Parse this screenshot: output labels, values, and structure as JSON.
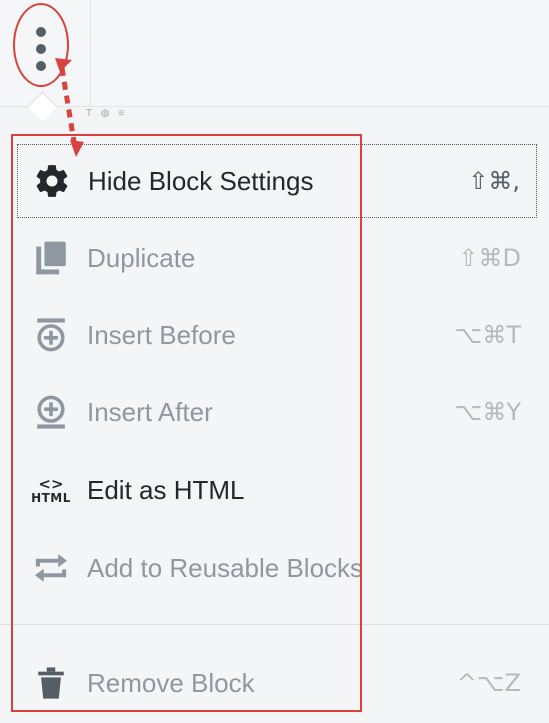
{
  "toolbar": {
    "more_button_icon": "vertical-ellipsis-icon",
    "mini_toolbar_text": "T ◍ ≡"
  },
  "menu": {
    "items": [
      {
        "label": "Hide Block Settings",
        "shortcut": "⇧⌘,",
        "icon": "gear-icon",
        "state": "focused"
      },
      {
        "label": "Duplicate",
        "shortcut": "⇧⌘D",
        "icon": "duplicate-icon",
        "state": "disabled"
      },
      {
        "label": "Insert Before",
        "shortcut": "⌥⌘T",
        "icon": "insert-before-icon",
        "state": "disabled"
      },
      {
        "label": "Insert After",
        "shortcut": "⌥⌘Y",
        "icon": "insert-after-icon",
        "state": "disabled"
      },
      {
        "label": "Edit as HTML",
        "shortcut": "",
        "icon": "html-icon",
        "state": "enabled"
      },
      {
        "label": "Add to Reusable Blocks",
        "shortcut": "",
        "icon": "reusable-icon",
        "state": "disabled"
      },
      {
        "label": "Remove Block",
        "shortcut": "^⌥Z",
        "icon": "trash-icon",
        "state": "disabled"
      }
    ],
    "html_icon_brackets": "<>",
    "html_icon_word": "HTML"
  },
  "colors": {
    "annotation": "#d9423f",
    "active_text": "#23282d",
    "disabled_text": "#8f98a1",
    "icon_dark": "#23282d",
    "icon_disabled": "#8f98a1"
  }
}
